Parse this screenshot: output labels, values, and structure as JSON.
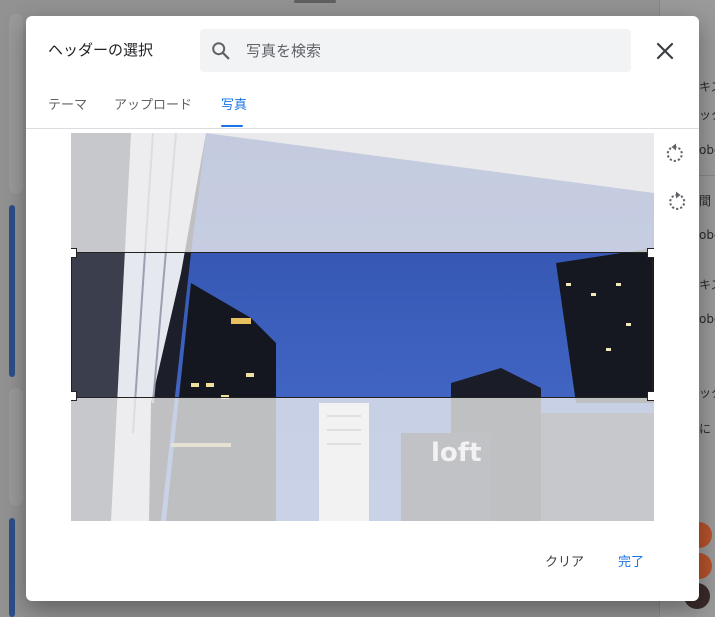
{
  "dialog": {
    "title": "ヘッダーの選択",
    "search": {
      "placeholder": "写真を検索",
      "value": ""
    },
    "close_icon": "close-icon"
  },
  "tabs": [
    {
      "label": "テーマ",
      "active": false
    },
    {
      "label": "アップロード",
      "active": false
    },
    {
      "label": "写真",
      "active": true
    }
  ],
  "photo": {
    "sign_text": "loft",
    "tools": [
      "rotate-left-icon",
      "rotate-right-icon"
    ]
  },
  "actions": {
    "clear_label": "クリア",
    "done_label": "完了"
  },
  "background": {
    "snippets": [
      "キス",
      "ッタ",
      "obo",
      "間",
      "obo",
      "キス",
      "obo",
      "ッタ",
      "に"
    ]
  },
  "colors": {
    "accent": "#1a73e8",
    "sky": "#3a5fb8"
  }
}
